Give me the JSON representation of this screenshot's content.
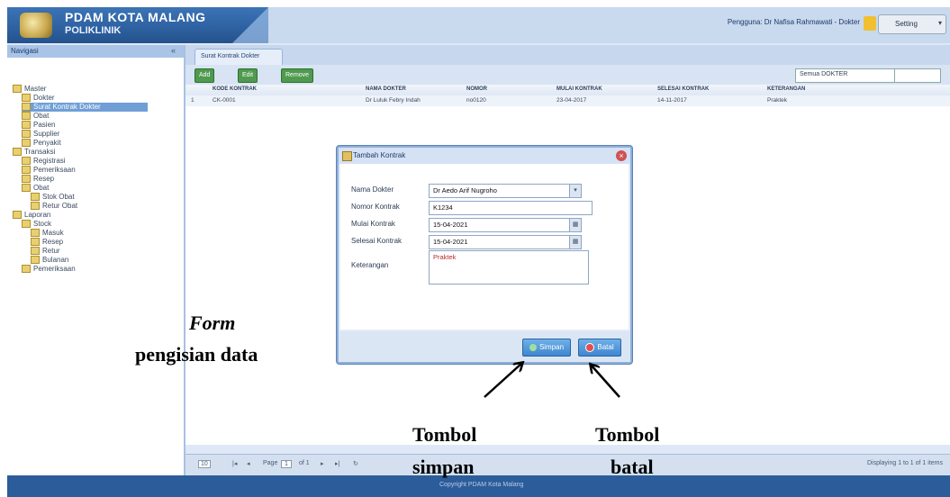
{
  "app": {
    "title": "PDAM KOTA MALANG",
    "subtitle": "POLIKLINIK",
    "user_info": "Pengguna: Dr Nafisa Rahmawati - Dokter",
    "setting_label": "Setting",
    "footer": "Copyright PDAM Kota Malang"
  },
  "nav": {
    "title": "Navigasi",
    "items": [
      {
        "label": "Master",
        "level": 0
      },
      {
        "label": "Dokter",
        "level": 1
      },
      {
        "label": "Surat Kontrak Dokter",
        "level": 1,
        "selected": true
      },
      {
        "label": "Obat",
        "level": 1
      },
      {
        "label": "Pasien",
        "level": 1
      },
      {
        "label": "Supplier",
        "level": 1
      },
      {
        "label": "Penyakit",
        "level": 1
      },
      {
        "label": "Transaksi",
        "level": 0
      },
      {
        "label": "Registrasi",
        "level": 1
      },
      {
        "label": "Pemeriksaan",
        "level": 1
      },
      {
        "label": "Resep",
        "level": 1
      },
      {
        "label": "Obat",
        "level": 1
      },
      {
        "label": "Stok Obat",
        "level": 2
      },
      {
        "label": "Retur Obat",
        "level": 2
      },
      {
        "label": "Laporan",
        "level": 0
      },
      {
        "label": "Stock",
        "level": 1
      },
      {
        "label": "Masuk",
        "level": 2
      },
      {
        "label": "Resep",
        "level": 2
      },
      {
        "label": "Retur",
        "level": 2
      },
      {
        "label": "Bulanan",
        "level": 2
      },
      {
        "label": "Pemeriksaan",
        "level": 1
      }
    ]
  },
  "main": {
    "tab_label": "Surat Kontrak Dokter",
    "toolbar": {
      "add": "Add",
      "edit": "Edit",
      "remove": "Remove",
      "search_by": "Semua DOKTER"
    },
    "grid": {
      "columns": [
        "KODE KONTRAK",
        "NAMA DOKTER",
        "NOMOR",
        "MULAI KONTRAK",
        "SELESAI KONTRAK",
        "KETERANGAN"
      ],
      "rows": [
        {
          "no": "1",
          "cells": [
            "CK-0001",
            "Dr Luluk Febry Indah",
            "no0120",
            "23-04-2017",
            "14-11-2017",
            "Praktek"
          ]
        }
      ]
    },
    "pager": {
      "page_size": "10",
      "page_label": "Page",
      "page_value": "1",
      "of_label": "of 1",
      "display_info": "Displaying 1 to 1 of 1 items"
    }
  },
  "modal": {
    "title": "Tambah Kontrak",
    "fields": {
      "nama_dokter_label": "Nama Dokter",
      "nama_dokter_value": "Dr Aedo Arif Nugroho",
      "nomor_kontrak_label": "Nomor Kontrak",
      "nomor_kontrak_value": "K1234",
      "mulai_kontrak_label": "Mulai Kontrak",
      "mulai_kontrak_value": "15-04-2021",
      "selesai_kontrak_label": "Selesai Kontrak",
      "selesai_kontrak_value": "15-04-2021",
      "keterangan_label": "Keterangan",
      "keterangan_value": "Praktek"
    },
    "simpan_label": "Simpan",
    "batal_label": "Batal"
  },
  "annotations": {
    "form": "Form",
    "pengisian": "pengisian data",
    "tombol_simpan_1": "Tombol",
    "tombol_simpan_2": "simpan",
    "tombol_batal_1": "Tombol",
    "tombol_batal_2": "batal"
  }
}
